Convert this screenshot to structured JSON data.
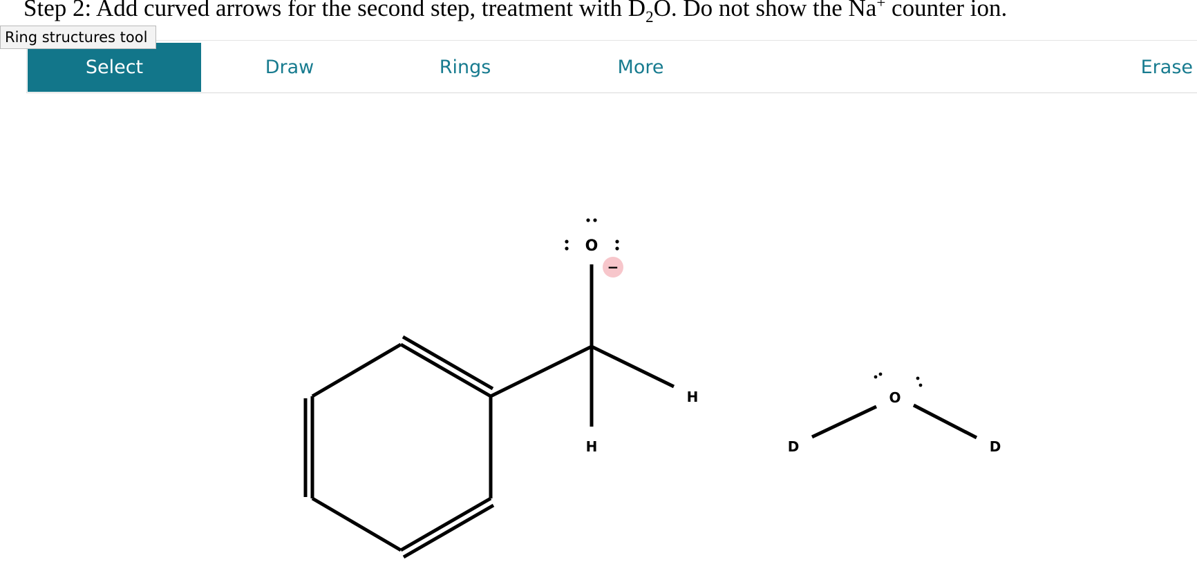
{
  "instruction": {
    "part1": "Step 2: Add curved arrows for the second step, treatment with D",
    "sub": "2",
    "part2": "O. Do not show the Na",
    "sup": "+",
    "part3": " counter ion."
  },
  "tooltip": "Ring structures tool",
  "toolbar": {
    "select": "Select",
    "draw": "Draw",
    "rings": "Rings",
    "more": "More",
    "erase": "Erase",
    "active_color": "#12768a",
    "text_color": "#177b8f"
  },
  "molecule": {
    "oxygen": "O",
    "charge": "−",
    "hydrogen_1": "H",
    "hydrogen_2": "H",
    "charge_color": "#f7c6cb"
  },
  "water": {
    "oxygen": "O",
    "deuterium_1": "D",
    "deuterium_2": "D"
  }
}
